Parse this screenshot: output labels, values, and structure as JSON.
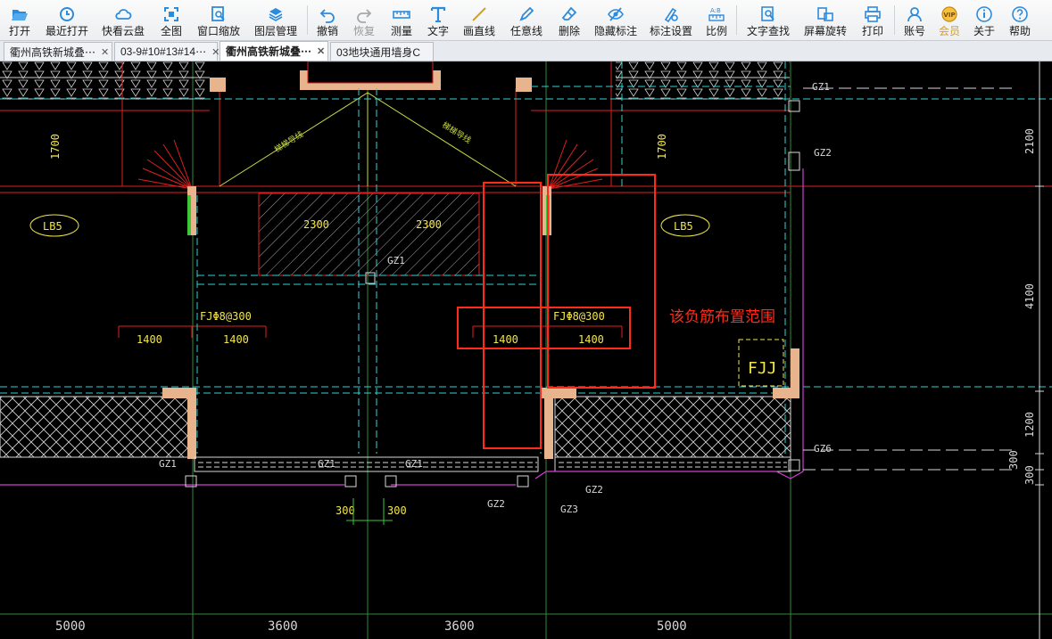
{
  "toolbar": {
    "items": [
      {
        "label": "打开",
        "icon": "folder-open-icon"
      },
      {
        "label": "最近打开",
        "icon": "clock-icon"
      },
      {
        "label": "快看云盘",
        "icon": "cloud-icon"
      },
      {
        "label": "全图",
        "icon": "fit-screen-icon"
      },
      {
        "label": "窗口缩放",
        "icon": "zoom-window-icon"
      },
      {
        "label": "图层管理",
        "icon": "layers-icon"
      },
      {
        "label": "撤销",
        "icon": "undo-icon"
      },
      {
        "label": "恢复",
        "icon": "redo-icon"
      },
      {
        "label": "测量",
        "icon": "ruler-icon"
      },
      {
        "label": "文字",
        "icon": "text-icon"
      },
      {
        "label": "画直线",
        "icon": "line-icon"
      },
      {
        "label": "任意线",
        "icon": "pencil-icon"
      },
      {
        "label": "删除",
        "icon": "eraser-icon"
      },
      {
        "label": "隐藏标注",
        "icon": "eye-off-icon"
      },
      {
        "label": "标注设置",
        "icon": "annotation-settings-icon"
      },
      {
        "label": "比例",
        "icon": "scale-icon"
      },
      {
        "label": "文字查找",
        "icon": "text-search-icon"
      },
      {
        "label": "屏幕旋转",
        "icon": "rotate-screen-icon"
      },
      {
        "label": "打印",
        "icon": "printer-icon"
      },
      {
        "label": "账号",
        "icon": "user-icon"
      },
      {
        "label": "会员",
        "icon": "vip-icon"
      },
      {
        "label": "关于",
        "icon": "info-icon"
      },
      {
        "label": "帮助",
        "icon": "help-icon"
      }
    ]
  },
  "tabs": [
    {
      "title": "衢州高铁新城叠⋯",
      "close": "✕",
      "active": false
    },
    {
      "title": "03-9#10#13#14⋯",
      "close": "✕",
      "active": false
    },
    {
      "title": "衢州高铁新城叠⋯",
      "close": "✕",
      "active": true
    },
    {
      "title": "03地块通用墙身C",
      "close": "",
      "active": false
    }
  ],
  "drawing": {
    "dims_vertical_left": "1700",
    "dims_vertical_mid": "1700",
    "dims_right": [
      "2100",
      "4100",
      "1200",
      "300",
      "300"
    ],
    "dim_2300_left": "2300",
    "dim_2300_right": "2300",
    "slab_left": "LB5",
    "slab_right": "LB5",
    "rebar_left": "FJΦ8@300",
    "rebar_right": "FJΦ8@300",
    "rebar_len_1": "1400",
    "rebar_len_2": "1400",
    "rebar_len_3": "1400",
    "rebar_len_4": "1400",
    "annotation": "该负筋布置范围",
    "fjj": "FJJ",
    "gz1_top": "GZ1",
    "gz2_top": "GZ2",
    "gz1_mid": "GZ1",
    "gz6": "GZ6",
    "gz1_bl": "GZ1",
    "gz1_b2": "GZ1",
    "gz1_b3": "GZ1",
    "gz2_b1": "GZ2",
    "gz2_b2": "GZ2",
    "gz3": "GZ3",
    "dim_300_a": "300",
    "dim_300_b": "300",
    "stair_label_1": "梯梯导线",
    "stair_label_2": "梯梯导线",
    "bottom_dims": [
      "5000",
      "3600",
      "3600",
      "5000"
    ]
  },
  "colors": {
    "annotation_red": "#ff2a1a",
    "wall_fill": "#e8b48e",
    "dim_yellow": "#f2e64a",
    "cyan": "#2fd4d4",
    "magenta": "#d23cd2"
  }
}
